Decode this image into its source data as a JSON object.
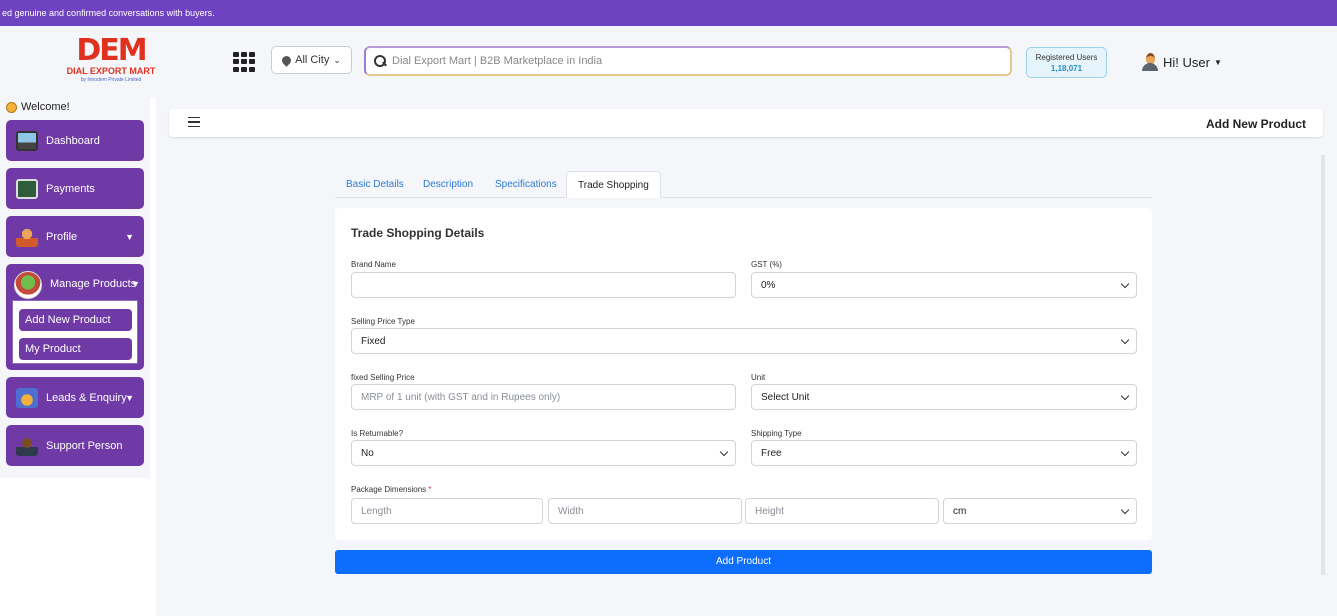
{
  "marquee": "ed genuine and confirmed conversations with buyers.",
  "logo": {
    "mark": "DEM",
    "name": "DIAL EXPORT MART",
    "sub": "by Innodem Private Limited"
  },
  "header": {
    "city": "All City",
    "search_placeholder": "Dial Export Mart | B2B Marketplace in India",
    "registered_label": "Registered Users",
    "registered_count": "1,18,071",
    "user_greeting": "Hi! User"
  },
  "sidebar": {
    "welcome": "Welcome!",
    "items": [
      {
        "label": "Dashboard",
        "icon": "monitor-icon"
      },
      {
        "label": "Payments",
        "icon": "payment-icon"
      },
      {
        "label": "Profile",
        "icon": "user-icon"
      },
      {
        "label": "Manage Products",
        "icon": "products-icon"
      },
      {
        "label": "Leads & Enquiry",
        "icon": "magnet-icon"
      },
      {
        "label": "Support Person",
        "icon": "support-icon"
      }
    ],
    "submenu": [
      "Add New Product",
      "My Product"
    ]
  },
  "page": {
    "title": "Add New Product"
  },
  "tabs": [
    "Basic Details",
    "Description",
    "Specifications",
    "Trade Shopping"
  ],
  "form": {
    "title": "Trade Shopping Details",
    "brand_label": "Brand Name",
    "brand_value": "",
    "gst_label": "GST (%)",
    "gst_value": "0%",
    "selling_type_label": "Selling Price Type",
    "selling_type_value": "Fixed",
    "fixed_price_label": "fixed Selling Price",
    "fixed_price_placeholder": "MRP of 1 unit (with GST and in Rupees only)",
    "unit_label": "Unit",
    "unit_value": "Select Unit",
    "returnable_label": "Is Returnable?",
    "returnable_value": "No",
    "shipping_label": "Shipping Type",
    "shipping_value": "Free",
    "dimensions_label": "Package Dimensions",
    "required_mark": "*",
    "length_placeholder": "Length",
    "width_placeholder": "Width",
    "height_placeholder": "Height",
    "dim_unit_value": "cm",
    "submit_label": "Add Product"
  },
  "colors": {
    "purple": "#6f3aa6",
    "banner": "#6f42c1",
    "primary": "#0d6efd"
  }
}
